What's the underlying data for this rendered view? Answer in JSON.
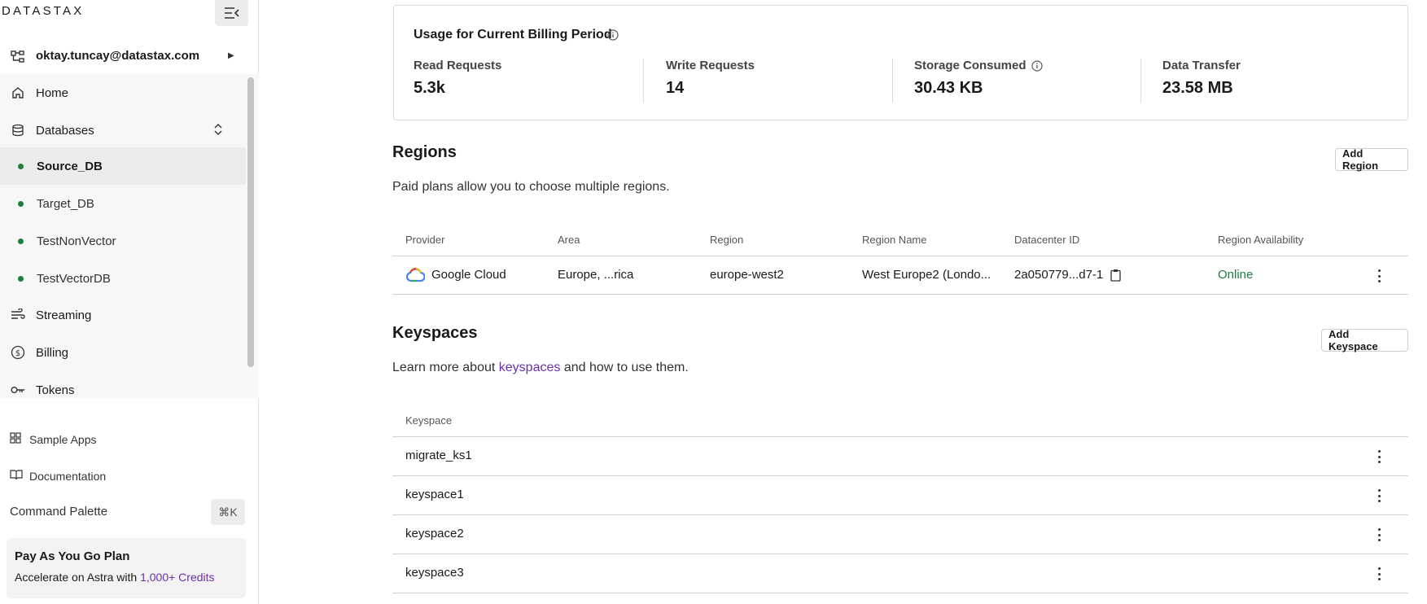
{
  "sidebar": {
    "logo": "DATASTAX",
    "org_email": "oktay.tuncay@datastax.com",
    "nav": [
      {
        "label": "Home",
        "icon": "home-icon"
      },
      {
        "label": "Databases",
        "icon": "database-icon"
      },
      {
        "label": "Streaming",
        "icon": "streaming-icon"
      },
      {
        "label": "Billing",
        "icon": "billing-icon"
      },
      {
        "label": "Tokens",
        "icon": "key-icon"
      }
    ],
    "databases": [
      {
        "label": "Source_DB",
        "status_color": "#1e7d3f",
        "active": true
      },
      {
        "label": "Target_DB",
        "status_color": "#1e7d3f"
      },
      {
        "label": "TestNonVector",
        "status_color": "#1e7d3f"
      },
      {
        "label": "TestVectorDB",
        "status_color": "#1e7d3f"
      }
    ],
    "bottom_links": [
      {
        "label": "Sample Apps",
        "icon": "grid-icon"
      },
      {
        "label": "Documentation",
        "icon": "book-icon"
      }
    ],
    "command_palette": {
      "label": "Command Palette",
      "shortcut": "⌘K"
    },
    "plan": {
      "title": "Pay As You Go Plan",
      "desc": "Accelerate on Astra with",
      "link": "1,000+ Credits"
    }
  },
  "usage": {
    "title": "Usage for Current Billing Period",
    "metrics": [
      {
        "label": "Read Requests",
        "value": "5.3k"
      },
      {
        "label": "Write Requests",
        "value": "14"
      },
      {
        "label": "Storage Consumed",
        "value": "30.43 KB"
      },
      {
        "label": "Data Transfer",
        "value": "23.58 MB"
      }
    ]
  },
  "regions": {
    "title": "Regions",
    "desc": "Paid plans allow you to choose multiple regions.",
    "add_button": "Add Region",
    "columns": [
      "Provider",
      "Area",
      "Region",
      "Region Name",
      "Datacenter ID",
      "Region Availability"
    ],
    "rows": [
      {
        "provider": "Google Cloud",
        "area": "Europe, ...rica",
        "region": "europe-west2",
        "region_name": "West Europe2 (Londo...",
        "datacenter_id": "2a050779...d7-1",
        "availability": "Online"
      }
    ]
  },
  "keyspaces": {
    "title": "Keyspaces",
    "desc_prefix": "Learn more about",
    "desc_link": "keyspaces",
    "desc_suffix": "and how to use them.",
    "add_button": "Add Keyspace",
    "column": "Keyspace",
    "rows": [
      "migrate_ks1",
      "keyspace1",
      "keyspace2",
      "keyspace3"
    ]
  },
  "colors": {
    "accent_link": "#6b2fa8",
    "status_online": "#1e7d3f"
  }
}
